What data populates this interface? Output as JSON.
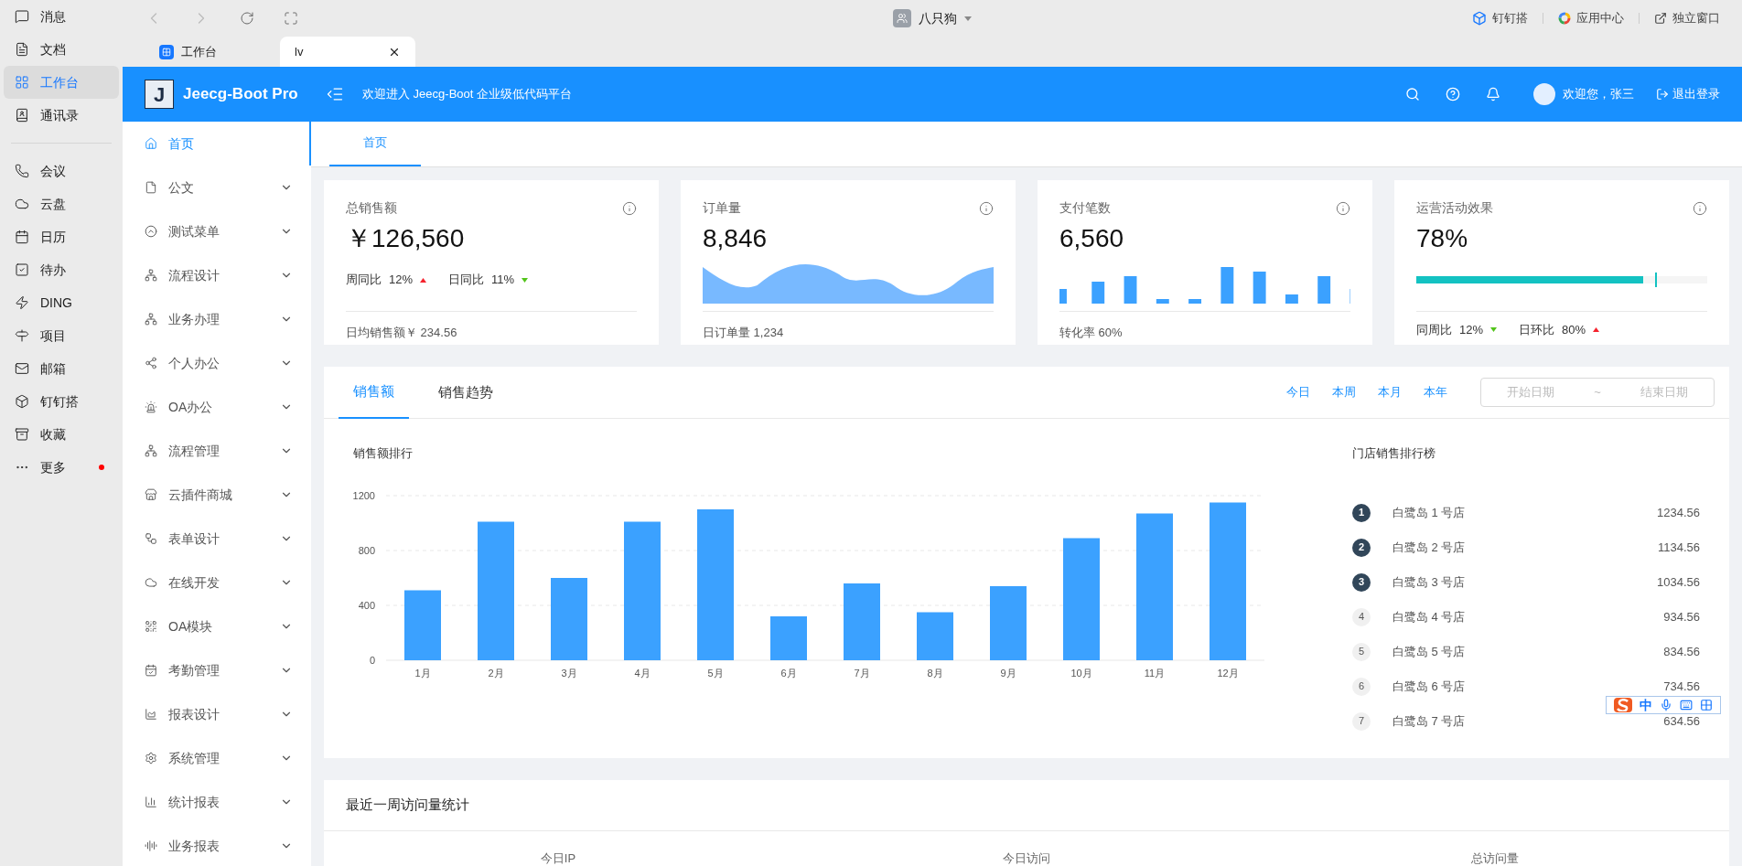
{
  "ding_sidebar": {
    "items": [
      {
        "label": "消息",
        "selected": false
      },
      {
        "label": "文档",
        "selected": false
      },
      {
        "label": "工作台",
        "selected": true
      },
      {
        "label": "通讯录",
        "selected": false
      }
    ],
    "items_2": [
      {
        "label": "会议",
        "selected": false,
        "badge": false
      },
      {
        "label": "云盘",
        "selected": false,
        "badge": false
      },
      {
        "label": "日历",
        "selected": false,
        "badge": false
      },
      {
        "label": "待办",
        "selected": false,
        "badge": false
      },
      {
        "label": "DING",
        "selected": false,
        "badge": false
      },
      {
        "label": "项目",
        "selected": false,
        "badge": false
      },
      {
        "label": "邮箱",
        "selected": false,
        "badge": false
      },
      {
        "label": "钉钉搭",
        "selected": false,
        "badge": false
      },
      {
        "label": "收藏",
        "selected": false,
        "badge": false
      },
      {
        "label": "更多",
        "selected": false,
        "badge": true
      }
    ]
  },
  "title_bar": {
    "app_name": "八只狗",
    "links": [
      "钉钉搭",
      "应用中心",
      "独立窗口"
    ]
  },
  "browser_tabs": [
    {
      "label": "工作台",
      "selected": false,
      "closable": false
    },
    {
      "label": "lv",
      "selected": true,
      "closable": true
    }
  ],
  "header": {
    "logo_letter": "J",
    "brand": "Jeecg-Boot Pro",
    "welcome": "欢迎进入 Jeecg-Boot 企业级低代码平台",
    "user": "欢迎您，张三",
    "logout": "退出登录"
  },
  "menu": [
    {
      "label": "首页",
      "selected": true,
      "expandable": false
    },
    {
      "label": "公文",
      "selected": false,
      "expandable": true
    },
    {
      "label": "测试菜单",
      "selected": false,
      "expandable": true
    },
    {
      "label": "流程设计",
      "selected": false,
      "expandable": true
    },
    {
      "label": "业务办理",
      "selected": false,
      "expandable": true
    },
    {
      "label": "个人办公",
      "selected": false,
      "expandable": true
    },
    {
      "label": "OA办公",
      "selected": false,
      "expandable": true
    },
    {
      "label": "流程管理",
      "selected": false,
      "expandable": true
    },
    {
      "label": "云插件商城",
      "selected": false,
      "expandable": true
    },
    {
      "label": "表单设计",
      "selected": false,
      "expandable": true
    },
    {
      "label": "在线开发",
      "selected": false,
      "expandable": true
    },
    {
      "label": "OA模块",
      "selected": false,
      "expandable": true
    },
    {
      "label": "考勤管理",
      "selected": false,
      "expandable": true
    },
    {
      "label": "报表设计",
      "selected": false,
      "expandable": true
    },
    {
      "label": "系统管理",
      "selected": false,
      "expandable": true
    },
    {
      "label": "统计报表",
      "selected": false,
      "expandable": true
    },
    {
      "label": "业务报表",
      "selected": false,
      "expandable": true
    }
  ],
  "page_tabs": [
    {
      "label": "首页",
      "selected": true
    }
  ],
  "stat_cards": [
    {
      "kind": "trends",
      "title": "总销售额",
      "value": "￥126,560",
      "trends": [
        {
          "label": "周同比",
          "value": "12%",
          "rising": true
        },
        {
          "label": "日同比",
          "value": "11%",
          "rising": false
        }
      ],
      "footer": "日均销售额￥ 234.56"
    },
    {
      "kind": "area",
      "title": "订单量",
      "value": "8,846",
      "footer": "日订单量 1,234"
    },
    {
      "kind": "bars",
      "title": "支付笔数",
      "value": "6,560",
      "footer": "转化率 60%"
    },
    {
      "kind": "progress",
      "title": "运营活动效果",
      "value": "78%",
      "level": 0.78,
      "trends": [
        {
          "label": "同周比",
          "value": "12%",
          "rising": false
        },
        {
          "label": "日环比",
          "value": "80%",
          "rising": true
        }
      ]
    }
  ],
  "sales": {
    "tabs": [
      {
        "label": "销售额",
        "selected": true
      },
      {
        "label": "销售趋势",
        "selected": false
      }
    ],
    "ranges": [
      "今日",
      "本周",
      "本月",
      "本年"
    ],
    "start_placeholder": "开始日期",
    "separator": "~",
    "end_placeholder": "结束日期",
    "chart_title": "销售额排行",
    "chart_data": {
      "type": "bar",
      "categories": [
        "1月",
        "2月",
        "3月",
        "4月",
        "5月",
        "6月",
        "7月",
        "8月",
        "9月",
        "10月",
        "11月",
        "12月"
      ],
      "series": [
        {
          "color": "#3ba1ff",
          "values": [
            510,
            1010,
            600,
            1010,
            1100,
            320,
            560,
            350,
            540,
            890,
            1070,
            1150
          ]
        }
      ],
      "ylim": [
        0,
        1200
      ],
      "yticks": [
        0,
        400,
        800,
        1200
      ]
    },
    "ranking_title": "门店销售排行榜",
    "ranking": [
      {
        "rank": "1",
        "name": "白鹭岛 1 号店",
        "value": "1234.56",
        "highlighted": true
      },
      {
        "rank": "2",
        "name": "白鹭岛 2 号店",
        "value": "1134.56",
        "highlighted": true
      },
      {
        "rank": "3",
        "name": "白鹭岛 3 号店",
        "value": "1034.56",
        "highlighted": true
      },
      {
        "rank": "4",
        "name": "白鹭岛 4 号店",
        "value": "934.56",
        "highlighted": false
      },
      {
        "rank": "5",
        "name": "白鹭岛 5 号店",
        "value": "834.56",
        "highlighted": false
      },
      {
        "rank": "6",
        "name": "白鹭岛 6 号店",
        "value": "734.56",
        "highlighted": false
      },
      {
        "rank": "7",
        "name": "白鹭岛 7 号店",
        "value": "634.56",
        "highlighted": false
      }
    ]
  },
  "visits": {
    "title": "最近一周访问量统计",
    "columns": [
      "今日IP",
      "今日访问",
      "总访问量"
    ]
  },
  "ime_bar": {
    "label": "中"
  }
}
